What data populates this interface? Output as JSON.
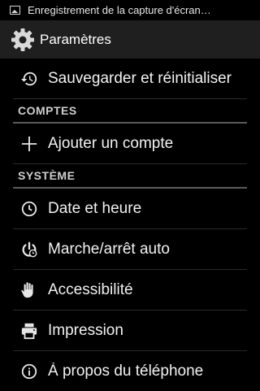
{
  "status_bar": {
    "notification_text": "Enregistrement de la capture d'écran…",
    "icon": "image-icon"
  },
  "action_bar": {
    "title": "Paramètres",
    "icon": "gear-icon"
  },
  "sections": [
    {
      "items": [
        {
          "label": "Sauvegarder et réinitialiser",
          "icon": "restore-icon"
        }
      ]
    },
    {
      "header": "COMPTES",
      "items": [
        {
          "label": "Ajouter un compte",
          "icon": "plus-icon"
        }
      ]
    },
    {
      "header": "SYSTÈME",
      "items": [
        {
          "label": "Date et heure",
          "icon": "clock-icon"
        },
        {
          "label": "Marche/arrêt auto",
          "icon": "power-clock-icon"
        },
        {
          "label": "Accessibilité",
          "icon": "hand-icon"
        },
        {
          "label": "Impression",
          "icon": "printer-icon"
        },
        {
          "label": "À propos du téléphone",
          "icon": "info-icon"
        }
      ]
    }
  ]
}
